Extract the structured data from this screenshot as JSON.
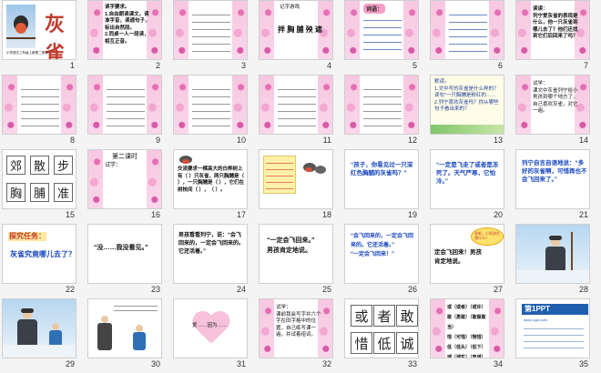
{
  "slides": [
    {
      "n": "1",
      "title": "灰雀",
      "caption": "小学语文三年级上册第二单元"
    },
    {
      "n": "2",
      "text": "读字要求。\n1.自由朗读课文，读准字音，读通句子，标出自然段。\n2.同桌一人一段读，相互正音。"
    },
    {
      "n": "3",
      "text": ""
    },
    {
      "n": "4",
      "heading": "记字游戏",
      "words": "拌 胸 脯 殃 遮"
    },
    {
      "n": "5",
      "tag": "词语：",
      "text": ""
    },
    {
      "n": "6",
      "text": ""
    },
    {
      "n": "7",
      "text": "读读：\n列宁爱灰雀的表现是什么，他一只灰雀到哪儿去了？他们还找到它们后回来了吗？"
    },
    {
      "n": "8",
      "text": ""
    },
    {
      "n": "9",
      "text": ""
    },
    {
      "n": "10",
      "text": ""
    },
    {
      "n": "11",
      "text": ""
    },
    {
      "n": "12",
      "text": ""
    },
    {
      "n": "13",
      "text": "默读。\n1.文中写的灰雀是什么样的？读句“一只胸脯是粉红的……\n2.列宁喜欢灰雀吗？你从哪些句子看出来的？"
    },
    {
      "n": "14",
      "text": "试学：\n课文中灰雀列宁给小男孩到哪个地方了，自己喜欢灰雀，对它一遍。"
    },
    {
      "n": "15",
      "chars": [
        "郊",
        "散",
        "步",
        "胸",
        "脯",
        "准"
      ]
    },
    {
      "n": "16",
      "heading": "第二课时",
      "sub": "试学："
    },
    {
      "n": "17",
      "text": "交流要求一棵高大的白桦树上有（ ）只灰雀，两只胸脯是（ ），一只胸脯是（ ），它们在树枝间（ ），（ ）。"
    },
    {
      "n": "18",
      "text": ""
    },
    {
      "n": "19",
      "text": "“孩子，你看见过一只深红色胸脯的灰雀吗？”"
    },
    {
      "n": "20",
      "text": "“一定是飞走了或者是冻死了。天气严寒，它怕冷。”"
    },
    {
      "n": "21",
      "text": "列宁自言自语地说：“多好的灰雀啊，可惜再也不会飞回来了。”"
    },
    {
      "n": "22",
      "heading": "探究任务：",
      "text": "灰雀究竟哪儿去了？"
    },
    {
      "n": "23",
      "text": "“没……我没看见。”"
    },
    {
      "n": "24",
      "text": "男孩看看列宁，说：“会飞回来的，一定会飞回来的。它还活着。”"
    },
    {
      "n": "25",
      "text": "“一定会飞回来。”\n男孩肯定地说。"
    },
    {
      "n": "26",
      "text": "“会飞回来的，一定会飞回来的。它还活着。”\n“一定会飞回来！”"
    },
    {
      "n": "27",
      "text": "定会飞回来！男孩肯定地说。",
      "bubble": "说吧，小男孩在想什么？"
    },
    {
      "n": "28",
      "text": ""
    },
    {
      "n": "29",
      "text": ""
    },
    {
      "n": "30",
      "text": ""
    },
    {
      "n": "31",
      "text": "爱……因为……"
    },
    {
      "n": "32",
      "text": "试学：\n课前我会写字并六个字在田字格中的位置，自己练写课一遍，并试着组词。"
    },
    {
      "n": "33",
      "chars": [
        "或",
        "者",
        "敢",
        "惜",
        "低",
        "诚"
      ]
    },
    {
      "n": "34",
      "text": "或（或者）（或许）\n敢（勇敢）（敢做敢当）\n惜（可惜）（惋惜）\n低（低头）（低下）\n诚（诚实）（忠诚）"
    },
    {
      "n": "35",
      "brand": "第1PPT",
      "url": "www.1ppt.com"
    }
  ]
}
